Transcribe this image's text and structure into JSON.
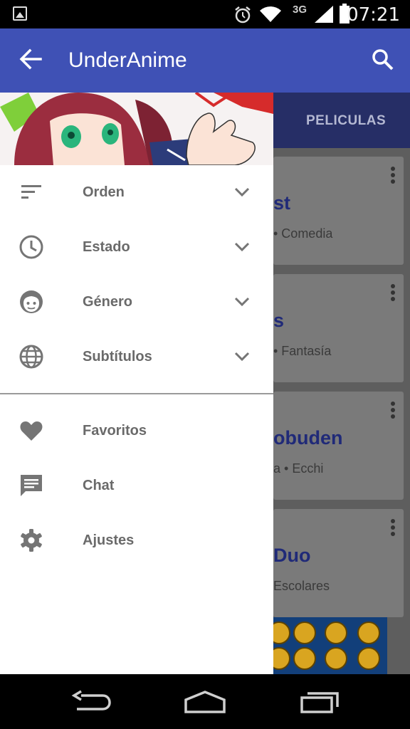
{
  "status_bar": {
    "network": "3G",
    "time": "07:21",
    "icons": [
      "gallery-icon",
      "alarm-icon",
      "wifi-icon",
      "signal-icon",
      "battery-icon"
    ]
  },
  "toolbar": {
    "title": "UnderAnime",
    "back_icon": "arrow-left-icon",
    "search_icon": "search-icon",
    "color": "#3f51b5"
  },
  "background": {
    "tab_label": "PELICULAS",
    "cards": [
      {
        "title": "st",
        "subtitle": "• Comedia"
      },
      {
        "title": "s",
        "subtitle": "• Fantasía"
      },
      {
        "title": "obuden",
        "subtitle": "a • Ecchi"
      },
      {
        "title": "Duo",
        "subtitle": "Escolares"
      }
    ]
  },
  "drawer": {
    "filters": [
      {
        "label": "Orden",
        "icon": "sort-icon"
      },
      {
        "label": "Estado",
        "icon": "clock-icon"
      },
      {
        "label": "Género",
        "icon": "face-icon"
      },
      {
        "label": "Subtítulos",
        "icon": "globe-icon"
      }
    ],
    "links": [
      {
        "label": "Favoritos",
        "icon": "heart-icon"
      },
      {
        "label": "Chat",
        "icon": "chat-icon"
      },
      {
        "label": "Ajustes",
        "icon": "gear-icon"
      }
    ]
  },
  "nav_bar": {
    "icons": [
      "back-nav-icon",
      "home-nav-icon",
      "recents-nav-icon"
    ]
  }
}
